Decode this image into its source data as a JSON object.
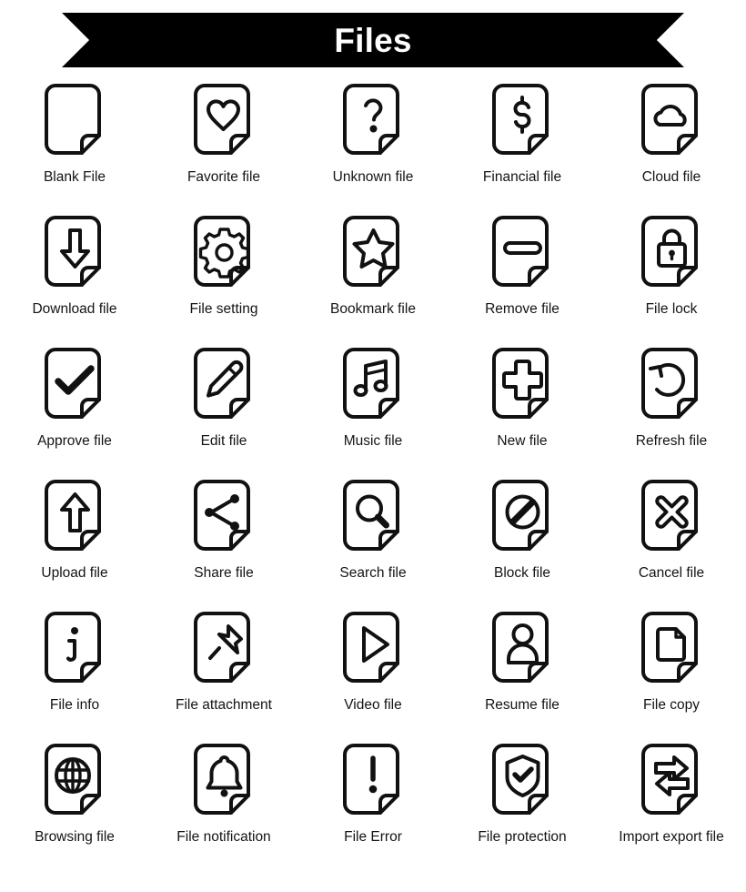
{
  "banner": {
    "title": "Files",
    "background_color": "#000000",
    "text_color": "#ffffff"
  },
  "style": {
    "stroke_color": "#111111",
    "background_color": "#ffffff"
  },
  "grid": {
    "columns": 5,
    "rows": 6,
    "total_icons": 30
  },
  "icons": [
    {
      "label": "Blank File",
      "icon": "blank-file-icon"
    },
    {
      "label": "Favorite file",
      "icon": "heart-icon"
    },
    {
      "label": "Unknown file",
      "icon": "question-mark-icon"
    },
    {
      "label": "Financial file",
      "icon": "dollar-sign-icon"
    },
    {
      "label": "Cloud file",
      "icon": "cloud-icon"
    },
    {
      "label": "Download file",
      "icon": "arrow-down-icon"
    },
    {
      "label": "File setting",
      "icon": "gear-icon"
    },
    {
      "label": "Bookmark file",
      "icon": "star-icon"
    },
    {
      "label": "Remove file",
      "icon": "minus-icon"
    },
    {
      "label": "File lock",
      "icon": "lock-icon"
    },
    {
      "label": "Approve file",
      "icon": "check-mark-icon"
    },
    {
      "label": "Edit file",
      "icon": "pencil-icon"
    },
    {
      "label": "Music file",
      "icon": "music-note-icon"
    },
    {
      "label": "New file",
      "icon": "plus-icon"
    },
    {
      "label": "Refresh file",
      "icon": "refresh-arrow-icon"
    },
    {
      "label": "Upload file",
      "icon": "arrow-up-icon"
    },
    {
      "label": "Share file",
      "icon": "share-nodes-icon"
    },
    {
      "label": "Search file",
      "icon": "magnifier-icon"
    },
    {
      "label": "Block file",
      "icon": "block-circle-icon"
    },
    {
      "label": "Cancel file",
      "icon": "cross-x-icon"
    },
    {
      "label": "File info",
      "icon": "info-i-icon"
    },
    {
      "label": "File attachment",
      "icon": "pushpin-icon"
    },
    {
      "label": "Video file",
      "icon": "play-triangle-icon"
    },
    {
      "label": "Resume file",
      "icon": "person-icon"
    },
    {
      "label": "File copy",
      "icon": "document-copy-icon"
    },
    {
      "label": "Browsing file",
      "icon": "globe-icon"
    },
    {
      "label": "File notification",
      "icon": "bell-icon"
    },
    {
      "label": "File Error",
      "icon": "exclamation-icon"
    },
    {
      "label": "File protection",
      "icon": "shield-check-icon"
    },
    {
      "label": "Import export file",
      "icon": "import-export-arrows-icon"
    }
  ]
}
